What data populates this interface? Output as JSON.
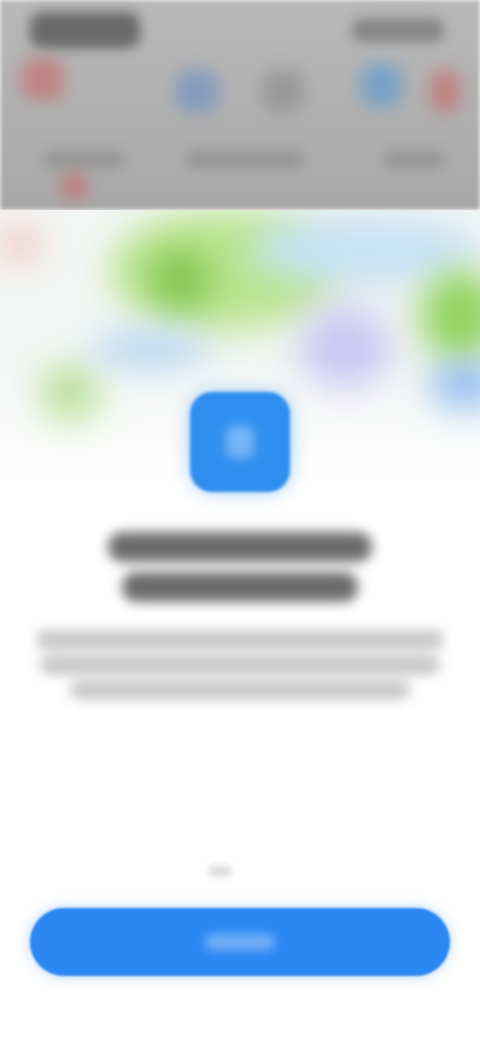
{
  "colors": {
    "accent": "#2b87f3",
    "app_tile": "#2f8ff0",
    "chrome_bg": "#b0b0b0",
    "map_green": "#a8dd7a",
    "map_water": "#a9cfef",
    "map_purple": "#c9c6f1"
  },
  "icons": {
    "app_tile": "location-app-icon",
    "chrome_icons": [
      "red-pin-icon",
      "blue-app-icon",
      "grey-app-icon",
      "blue-app-icon",
      "red-app-icon"
    ]
  }
}
